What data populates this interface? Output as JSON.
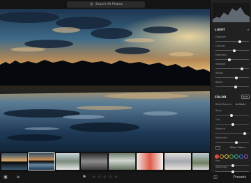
{
  "search": {
    "placeholder": "Search All Photos",
    "icon": "search-icon"
  },
  "panel": {
    "light_title": "LIGHT",
    "color_title": "COLOR",
    "bw_label": "B&W",
    "white_balance": {
      "label": "White Balance",
      "value": "As Shot ▾"
    },
    "mixer": {
      "label": "Mixer",
      "value": "Color ▾"
    },
    "light_sliders": [
      {
        "label": "Exposure",
        "value": 0.72
      },
      {
        "label": "Contrast",
        "value": 0.55
      },
      {
        "label": "Highlights",
        "value": 0.4
      },
      {
        "label": "Shadows",
        "value": 0.78
      },
      {
        "label": "Whites",
        "value": 0.6
      },
      {
        "label": "Blacks",
        "value": 0.58
      }
    ],
    "color_sliders": [
      {
        "label": "Temp",
        "value": 0.45
      },
      {
        "label": "Tint",
        "value": 0.5
      },
      {
        "label": "Vibrance",
        "value": 0.88
      },
      {
        "label": "Saturation",
        "value": 0.6
      }
    ],
    "extra_sliders": [
      {
        "label": "Hue",
        "value": 0.5
      },
      {
        "label": "Saturation",
        "value": 0.5
      }
    ],
    "swatch_colors": [
      "#e04a3a",
      "#e89a2c",
      "#e8d23a",
      "#5cc24a",
      "#37b7b0",
      "#3a7de0",
      "#9b59d0"
    ]
  },
  "bottombar": {
    "presets_label": "Presets",
    "stars": [
      "☆",
      "☆",
      "☆",
      "☆",
      "☆"
    ]
  },
  "colors": {
    "accent": "#e8e8e8",
    "panel_bg": "#212121"
  }
}
